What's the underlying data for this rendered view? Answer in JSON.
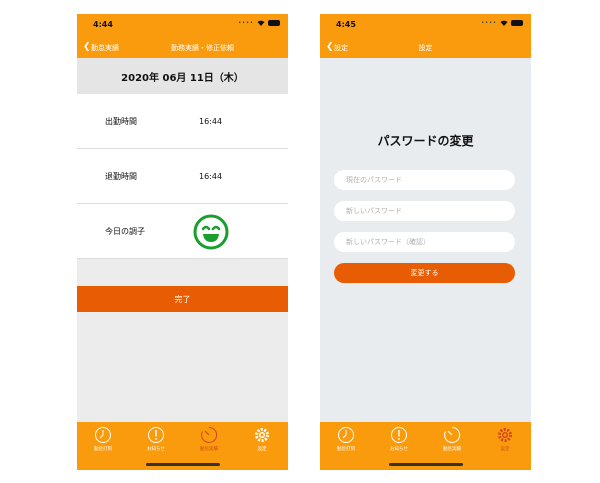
{
  "phone1": {
    "status_time": "4:44",
    "back_label": "勤怠実績",
    "nav_title": "勤務実績・修正依頼",
    "date": "2020年 06月 11日（木）",
    "rows": [
      {
        "label": "出勤時間",
        "value": "16:44"
      },
      {
        "label": "退勤時間",
        "value": "16:44"
      },
      {
        "label": "今日の調子",
        "mood_icon": "smiley-icon"
      }
    ],
    "done_label": "完了",
    "tabs": [
      {
        "label": "勤怠打刻",
        "icon": "clock-icon"
      },
      {
        "label": "お知らせ",
        "icon": "alert-icon"
      },
      {
        "label": "勤怠実績",
        "icon": "timer-icon",
        "active": true
      },
      {
        "label": "設定",
        "icon": "gear-icon"
      }
    ]
  },
  "phone2": {
    "status_time": "4:45",
    "back_label": "設定",
    "nav_title": "設定",
    "heading": "パスワードの変更",
    "current_placeholder": "現在のパスワード",
    "new_placeholder": "新しいパスワード",
    "confirm_placeholder": "新しいパスワード（確認）",
    "submit_label": "変更する",
    "tabs": [
      {
        "label": "勤怠打刻",
        "icon": "clock-icon"
      },
      {
        "label": "お知らせ",
        "icon": "alert-icon"
      },
      {
        "label": "勤怠実績",
        "icon": "timer-icon"
      },
      {
        "label": "設定",
        "icon": "gear-icon",
        "active": true
      }
    ]
  },
  "colors": {
    "brand": "#f99b0d",
    "accent": "#e85d04",
    "smiley": "#1a9e2e",
    "active_tab": "#d2491c"
  }
}
